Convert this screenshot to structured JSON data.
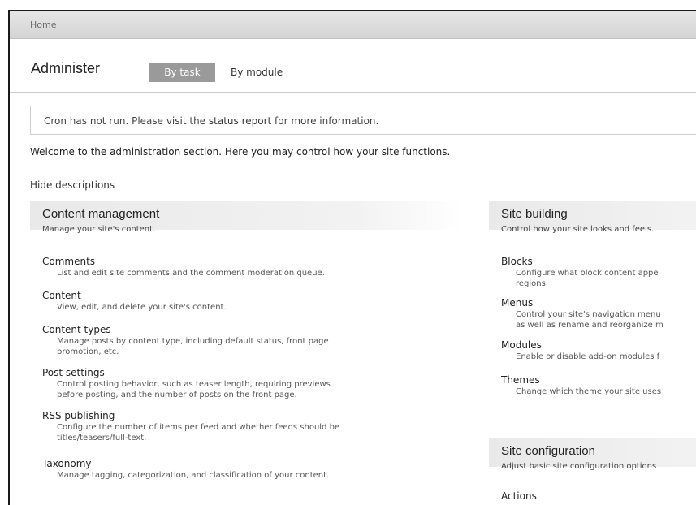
{
  "breadcrumb": {
    "home": "Home"
  },
  "page": {
    "title": "Administer"
  },
  "tabs": [
    {
      "label": "By task"
    },
    {
      "label": "By module"
    }
  ],
  "status_message": {
    "before": "Cron has not run. Please visit the ",
    "link": "status report",
    "after": " for more information."
  },
  "welcome": "Welcome to the administration section. Here you may control how your site functions.",
  "hide_descriptions": "Hide descriptions",
  "content_management": {
    "title": "Content management",
    "description": "Manage your site's content.",
    "items": [
      {
        "title": "Comments",
        "desc": [
          "List and edit site comments and the comment moderation queue."
        ]
      },
      {
        "title": "Content",
        "desc": [
          "View, edit, and delete your site's content."
        ]
      },
      {
        "title": "Content types",
        "desc": [
          "Manage posts by content type, including default status, front page",
          "promotion, etc."
        ]
      },
      {
        "title": "Post settings",
        "desc": [
          "Control posting behavior, such as teaser length, requiring previews",
          "before posting, and the number of posts on the front page."
        ]
      },
      {
        "title": "RSS publishing",
        "desc": [
          "Configure the number of items per feed and whether feeds should be",
          "titles/teasers/full-text."
        ]
      },
      {
        "title": "Taxonomy",
        "desc": [
          "Manage tagging, categorization, and classification of your content."
        ]
      }
    ]
  },
  "site_building": {
    "title": "Site building",
    "description": "Control how your site looks and feels.",
    "items": [
      {
        "title": "Blocks",
        "desc": [
          "Configure what block content appe",
          "regions."
        ]
      },
      {
        "title": "Menus",
        "desc": [
          "Control your site's navigation menu",
          "as well as rename and reorganize m"
        ]
      },
      {
        "title": "Modules",
        "desc": [
          "Enable or disable add-on modules f"
        ]
      },
      {
        "title": "Themes",
        "desc": [
          "Change which theme your site uses"
        ]
      }
    ]
  },
  "site_configuration": {
    "title": "Site configuration",
    "description": "Adjust basic site configuration options",
    "items": [
      {
        "title": "Actions"
      }
    ]
  }
}
